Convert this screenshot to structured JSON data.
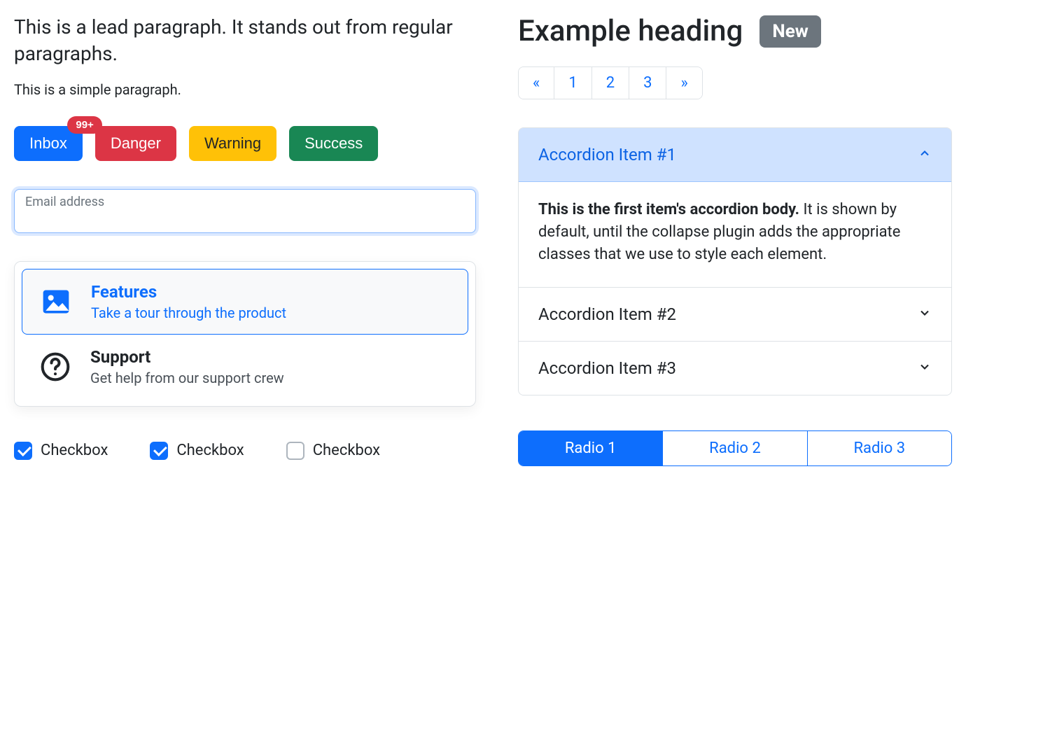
{
  "left": {
    "lead": "This is a lead paragraph. It stands out from regular paragraphs.",
    "para": "This is a simple paragraph.",
    "buttons": {
      "inbox": {
        "label": "Inbox",
        "badge": "99+"
      },
      "danger": "Danger",
      "warning": "Warning",
      "success": "Success"
    },
    "email": {
      "placeholder": "Email address",
      "value": ""
    },
    "list": {
      "items": [
        {
          "title": "Features",
          "sub": "Take a tour through the product",
          "active": true
        },
        {
          "title": "Support",
          "sub": "Get help from our support crew",
          "active": false
        }
      ]
    },
    "checkboxes": [
      {
        "label": "Checkbox",
        "checked": true
      },
      {
        "label": "Checkbox",
        "checked": true
      },
      {
        "label": "Checkbox",
        "checked": false
      }
    ]
  },
  "right": {
    "heading": "Example heading",
    "badge": "New",
    "pagination": {
      "prev": "«",
      "pages": [
        "1",
        "2",
        "3"
      ],
      "next": "»"
    },
    "accordion": {
      "items": [
        {
          "title": "Accordion Item #1",
          "open": true,
          "body_strong": "This is the first item's accordion body.",
          "body_rest": " It is shown by default, until the collapse plugin adds the appropriate classes that we use to style each element."
        },
        {
          "title": "Accordion Item #2",
          "open": false
        },
        {
          "title": "Accordion Item #3",
          "open": false
        }
      ]
    },
    "radios": [
      {
        "label": "Radio 1",
        "active": true
      },
      {
        "label": "Radio 2",
        "active": false
      },
      {
        "label": "Radio 3",
        "active": false
      }
    ]
  }
}
